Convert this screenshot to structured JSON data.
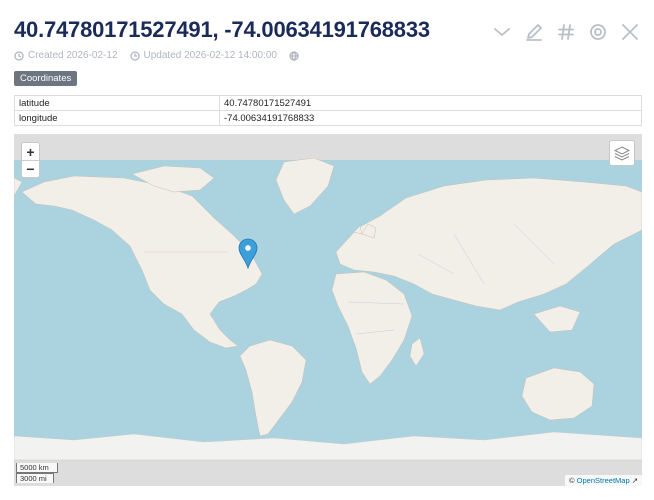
{
  "header": {
    "title": "40.74780171527491, -74.00634191768833",
    "created_label": "Created 2026-02-12",
    "updated_label": "Updated 2026-02-12 14:00:00"
  },
  "toolbar": {
    "icons": [
      "chevron-down-icon",
      "pencil-icon",
      "hash-icon",
      "target-icon",
      "close-icon"
    ]
  },
  "tag": {
    "label": "Coordinates"
  },
  "properties": {
    "rows": [
      {
        "key": "latitude",
        "value": "40.74780171527491"
      },
      {
        "key": "longitude",
        "value": "-74.00634191768833"
      }
    ]
  },
  "map": {
    "zoom_in": "+",
    "zoom_out": "−",
    "scale_km": "5000 km",
    "scale_mi": "3000 mi",
    "attribution_prefix": "© ",
    "attribution_link": "OpenStreetMap",
    "attribution_suffix": " ↗",
    "marker": {
      "lat": 40.74780171527491,
      "lon": -74.00634191768833
    },
    "colors": {
      "ocean": "#aad3df",
      "land": "#f2efe9",
      "ice": "#f2f2f0",
      "marker": "#3d9fd9"
    }
  }
}
